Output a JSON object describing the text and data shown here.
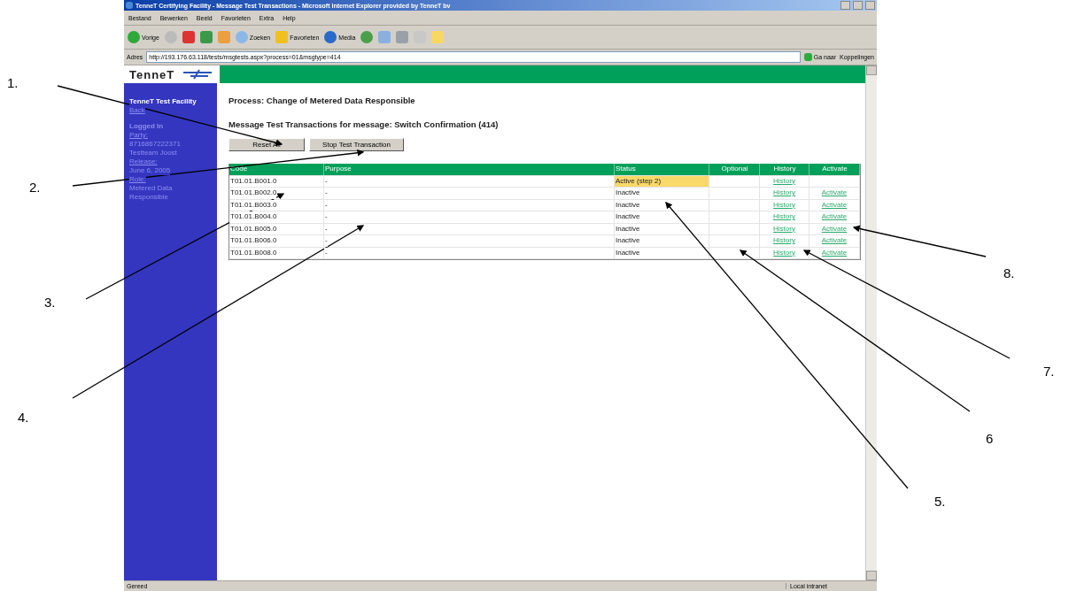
{
  "window": {
    "title": "TenneT Certifying Facility - Message Test Transactions - Microsoft Internet Explorer provided by TenneT bv"
  },
  "menu": [
    "Bestand",
    "Bewerken",
    "Beeld",
    "Favorieten",
    "Extra",
    "Help"
  ],
  "toolbar": {
    "back": "Vorige",
    "search": "Zoeken",
    "favorites": "Favorieten",
    "media": "Media"
  },
  "address_bar": {
    "label": "Adres",
    "url": "http://193.176.63.118/tests/msgtests.aspx?process=01&msgtype=414",
    "go": "Ga naar",
    "links": "Koppelingen"
  },
  "logo": "TenneT",
  "sidebar": [
    {
      "kind": "heading",
      "text": "TenneT Test Facility"
    },
    {
      "kind": "link",
      "text": "Back"
    },
    {
      "kind": "section",
      "text": "Logged In"
    },
    {
      "kind": "link",
      "text": "Party:"
    },
    {
      "kind": "text",
      "text": "8716867222371"
    },
    {
      "kind": "text",
      "text": "Testteam Joost"
    },
    {
      "kind": "link",
      "text": "Release:"
    },
    {
      "kind": "text",
      "text": "June 6, 2005"
    },
    {
      "kind": "link",
      "text": "Role:"
    },
    {
      "kind": "text",
      "text": "Metered Data Responsible"
    }
  ],
  "process_title": "Process: Change of Metered Data Responsible",
  "message_title": "Message Test Transactions for message: Switch Confirmation (414)",
  "buttons": [
    "Reset All",
    "Stop Test Transaction"
  ],
  "table": {
    "columns": [
      "Code",
      "Purpose",
      "Status",
      "Optional",
      "History",
      "Activate"
    ],
    "rows": [
      {
        "code": "T01.01.B001.0",
        "purpose": "-",
        "status": "Active (step 2)",
        "active": true,
        "history": "History"
      },
      {
        "code": "T01.01.B002.0",
        "purpose": "-",
        "status": "Inactive",
        "active": false,
        "history": "History",
        "activate": "Activate"
      },
      {
        "code": "T01.01.B003.0",
        "purpose": "-",
        "status": "Inactive",
        "active": false,
        "history": "History",
        "activate": "Activate"
      },
      {
        "code": "T01.01.B004.0",
        "purpose": "-",
        "status": "Inactive",
        "active": false,
        "history": "History",
        "activate": "Activate"
      },
      {
        "code": "T01.01.B005.0",
        "purpose": "-",
        "status": "Inactive",
        "active": false,
        "history": "History",
        "activate": "Activate"
      },
      {
        "code": "T01.01.B006.0",
        "purpose": "-",
        "status": "Inactive",
        "active": false,
        "history": "History",
        "activate": "Activate"
      },
      {
        "code": "T01.01.B008.0",
        "purpose": "-",
        "status": "Inactive",
        "active": false,
        "history": "History",
        "activate": "Activate"
      }
    ]
  },
  "status_bar": {
    "text": "Gereed",
    "zone": "Local intranet"
  },
  "annotations": [
    "1.",
    "2.",
    "3.",
    "4.",
    "5.",
    "6",
    "7.",
    "8."
  ]
}
